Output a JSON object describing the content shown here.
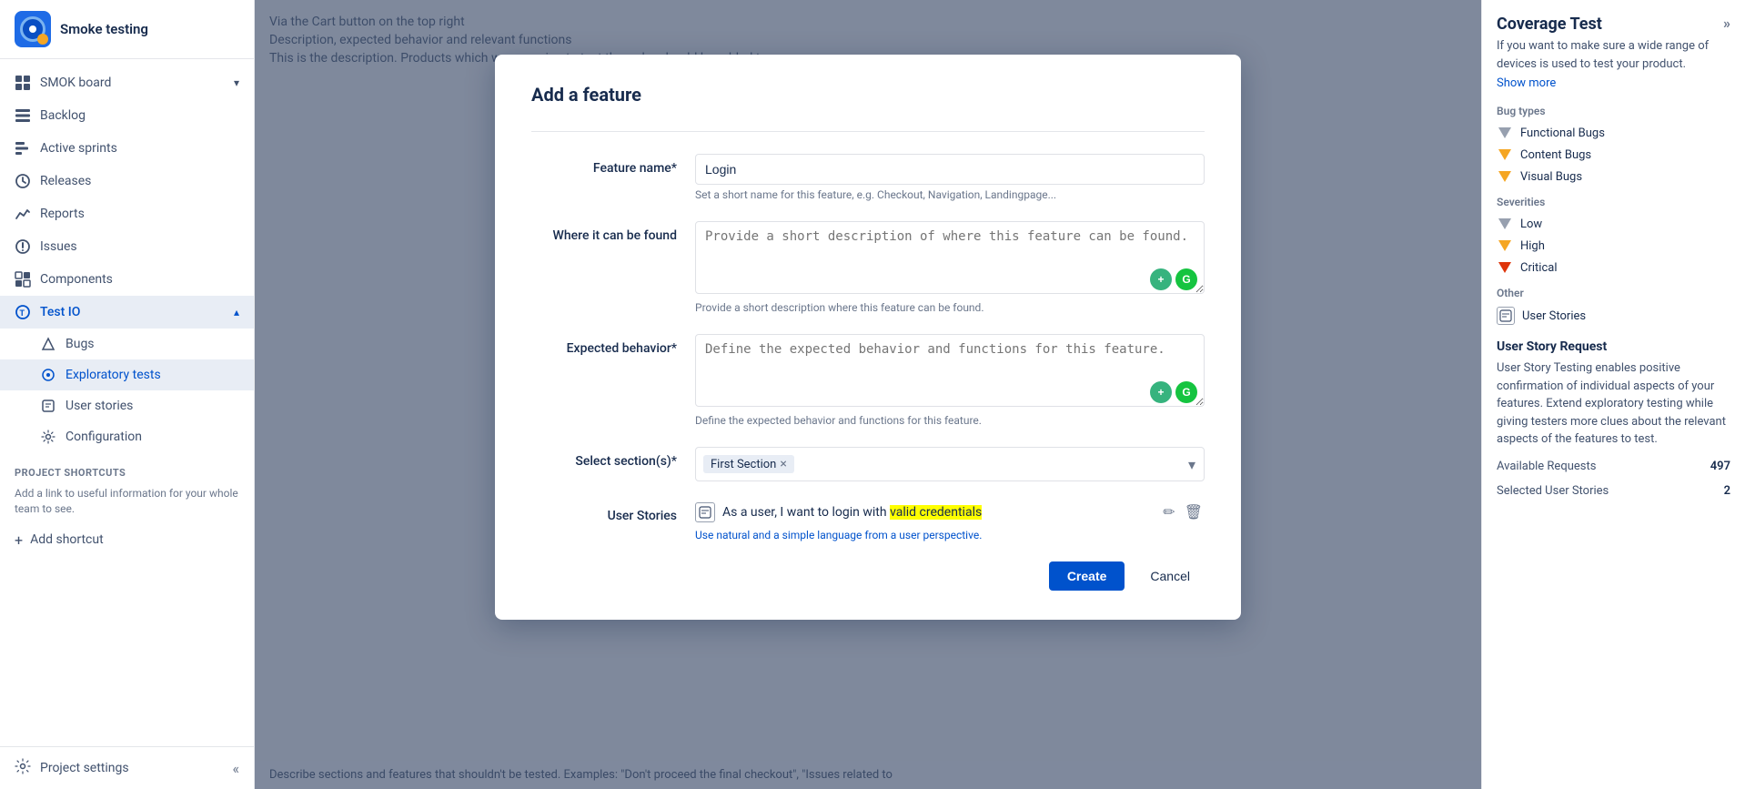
{
  "app": {
    "title": "Smoke testing"
  },
  "sidebar": {
    "header_title": "Smoke testing",
    "items": [
      {
        "id": "smok-board",
        "label": "SMOK board",
        "icon": "board-icon",
        "has_chevron": true
      },
      {
        "id": "backlog",
        "label": "Backlog",
        "icon": "backlog-icon",
        "has_chevron": false
      },
      {
        "id": "active-sprints",
        "label": "Active sprints",
        "icon": "sprint-icon",
        "has_chevron": false
      },
      {
        "id": "releases",
        "label": "Releases",
        "icon": "releases-icon",
        "has_chevron": false
      },
      {
        "id": "reports",
        "label": "Reports",
        "icon": "reports-icon",
        "has_chevron": false
      },
      {
        "id": "issues",
        "label": "Issues",
        "icon": "issues-icon",
        "has_chevron": false
      },
      {
        "id": "components",
        "label": "Components",
        "icon": "components-icon",
        "has_chevron": false
      }
    ],
    "testio": {
      "label": "Test IO",
      "icon": "testio-icon",
      "is_expanded": true,
      "sub_items": [
        {
          "id": "bugs",
          "label": "Bugs",
          "icon": "bugs-icon"
        },
        {
          "id": "exploratory-tests",
          "label": "Exploratory tests",
          "icon": "exploratory-icon",
          "is_active": true
        },
        {
          "id": "user-stories",
          "label": "User stories",
          "icon": "user-stories-icon"
        },
        {
          "id": "configuration",
          "label": "Configuration",
          "icon": "configuration-icon"
        }
      ]
    },
    "shortcuts": {
      "section_label": "PROJECT SHORTCUTS",
      "desc": "Add a link to useful information for your whole team to see.",
      "add_label": "Add shortcut"
    },
    "footer": {
      "settings_label": "Project settings",
      "settings_icon": "settings-icon",
      "collapse_icon": "chevron-left-icon"
    }
  },
  "right_panel": {
    "title": "Coverage Test",
    "expand_label": "»",
    "description": "If you want to make sure a wide range of devices is used to test your product.",
    "show_more": "Show more",
    "bug_types_label": "Bug types",
    "bug_types": [
      {
        "id": "functional",
        "label": "Functional Bugs",
        "color": "#97a0af",
        "shape": "triangle-down-gray"
      },
      {
        "id": "content",
        "label": "Content Bugs",
        "color": "#f5a623",
        "shape": "triangle-down-yellow"
      },
      {
        "id": "visual",
        "label": "Visual Bugs",
        "color": "#f5a623",
        "shape": "triangle-down-yellow2"
      }
    ],
    "severities_label": "Severities",
    "severities": [
      {
        "id": "low",
        "label": "Low",
        "color": "#97a0af"
      },
      {
        "id": "high",
        "label": "High",
        "color": "#f5a623"
      },
      {
        "id": "critical",
        "label": "Critical",
        "color": "#de350b"
      }
    ],
    "other_label": "Other",
    "other_items": [
      {
        "id": "user-stories",
        "label": "User Stories"
      }
    ],
    "user_story_request_title": "User Story Request",
    "user_story_request_desc": "User Story Testing enables positive confirmation of individual aspects of your features. Extend exploratory testing while giving testers more clues about the relevant aspects of the features to test.",
    "available_requests_label": "Available Requests",
    "available_requests_value": "497",
    "selected_user_stories_label": "Selected User Stories",
    "selected_user_stories_value": "2"
  },
  "modal": {
    "title": "Add a feature",
    "feature_name_label": "Feature name*",
    "feature_name_value": "Login",
    "feature_name_placeholder": "Set a short name for this feature, e.g. Checkout, Navigation, Landingpage...",
    "where_found_label": "Where it can be found",
    "where_found_placeholder": "Provide a short description of where this feature can be found.",
    "where_found_hint": "Provide a short description where this feature can be found.",
    "expected_behavior_label": "Expected behavior*",
    "expected_behavior_placeholder": "Define the expected behavior and functions for this feature.",
    "expected_behavior_hint": "Define the expected behavior and functions for this feature.",
    "select_sections_label": "Select section(s)*",
    "selected_tag": "First Section",
    "user_stories_label": "User Stories",
    "user_story_text": "As a user, I want to login with valid credentials",
    "user_story_hint": "Use natural and a simple language from a user perspective.",
    "create_button": "Create",
    "cancel_button": "Cancel"
  },
  "background": {
    "lines": [
      "Via the Cart button on the top right",
      "Description, expected behavior and relevant functions",
      "This is the description. Products which we are using to test the order should be added to..."
    ],
    "bottom_text": "Describe sections and features that shouldn't be tested. Examples: \"Don't proceed the final checkout\", \"Issues related to"
  }
}
